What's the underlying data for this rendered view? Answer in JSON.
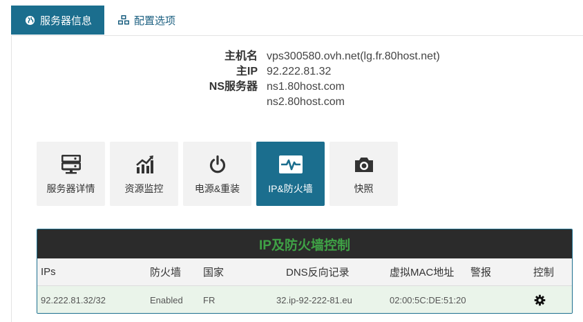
{
  "tabs": [
    {
      "label": "服务器信息",
      "icon": "globe-icon",
      "active": true
    },
    {
      "label": "配置选项",
      "icon": "cubes-icon",
      "active": false
    }
  ],
  "info": {
    "hostname_label": "主机名",
    "hostname_value": "vps300580.ovh.net(lg.fr.80host.net)",
    "ip_label": "主IP",
    "ip_value": "92.222.81.32",
    "ns_label": "NS服务器",
    "ns1": "ns1.80host.com",
    "ns2": "ns2.80host.com"
  },
  "tiles": [
    {
      "label": "服务器详情",
      "icon": "server-icon"
    },
    {
      "label": "资源监控",
      "icon": "chart-icon"
    },
    {
      "label": "电源&重装",
      "icon": "power-icon"
    },
    {
      "label": "IP&防火墙",
      "icon": "heartbeat-icon",
      "active": true
    },
    {
      "label": "快照",
      "icon": "camera-icon"
    }
  ],
  "firewall": {
    "title": "IP及防火墙控制",
    "columns": [
      "IPs",
      "防火墙",
      "国家",
      "DNS反向记录",
      "虚拟MAC地址",
      "警报",
      "控制"
    ],
    "rows": [
      {
        "ip": "92.222.81.32/32",
        "firewall": "Enabled",
        "country": "FR",
        "rdns": "32.ip-92-222-81.eu",
        "mac": "02:00:5C:DE:51:20",
        "alert": "",
        "control_icon": "gear-icon"
      }
    ]
  },
  "colors": {
    "accent": "#1b6e8e",
    "title_green": "#3fa246",
    "row_bg": "#eaf4ea"
  }
}
